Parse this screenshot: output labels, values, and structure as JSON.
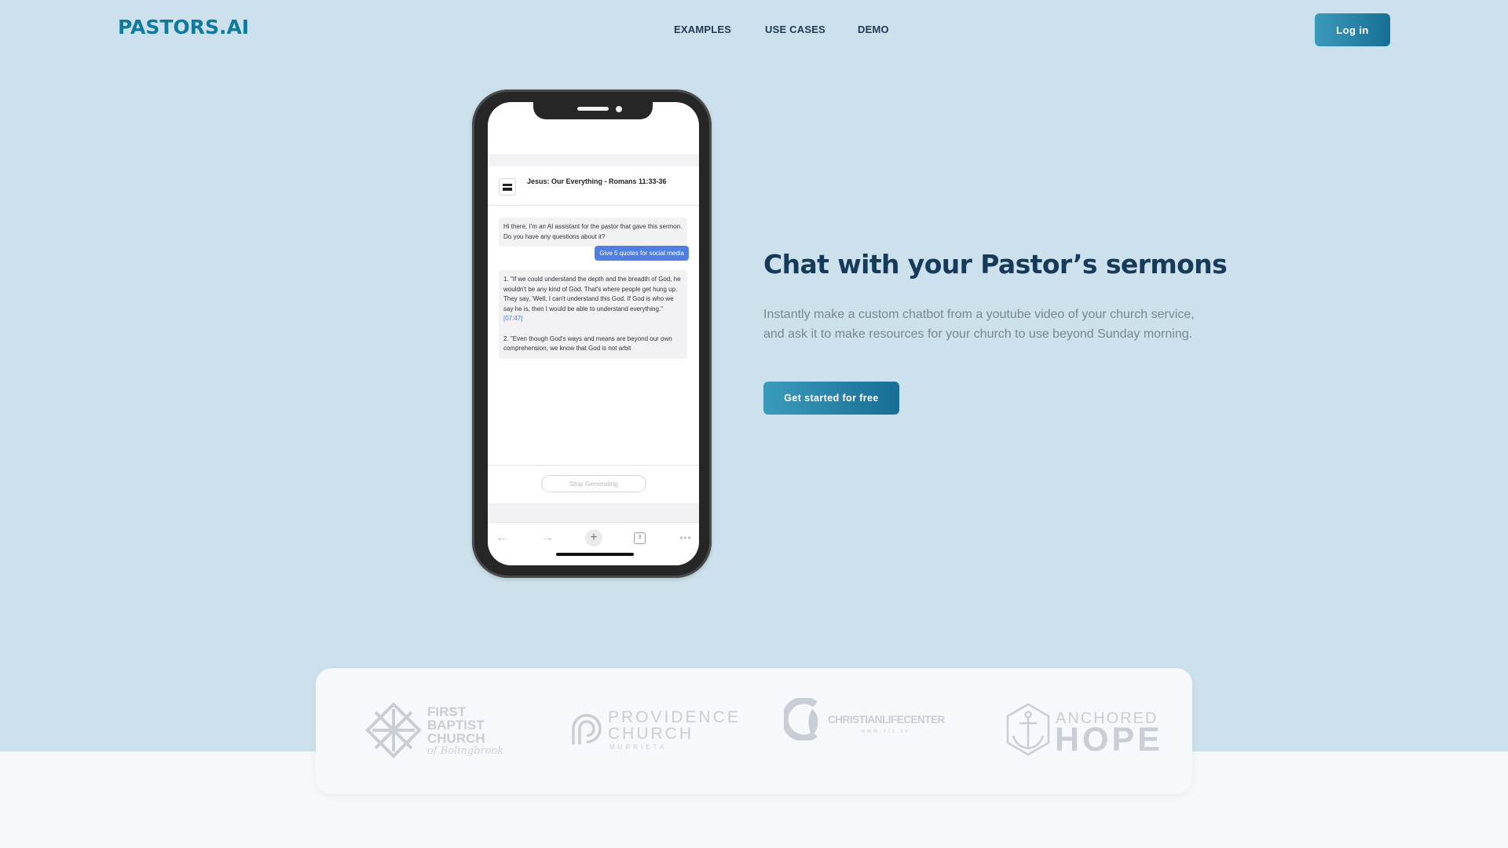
{
  "brand": {
    "name": "PASTORS.AI",
    "color": "#0f7aa0"
  },
  "nav": {
    "links": [
      {
        "label": "EXAMPLES"
      },
      {
        "label": "USE CASES"
      },
      {
        "label": "DEMO"
      }
    ],
    "login_label": "Log in"
  },
  "hero": {
    "title": "Chat with your Pastor’s sermons",
    "description": "Instantly make a custom chatbot from a youtube video of your church service, and ask it to make resources for your church to use beyond Sunday morning.",
    "cta_label": "Get started for free"
  },
  "phone_demo": {
    "sermon_title": "Jesus: Our Everything - Romans 11:33-36",
    "messages": [
      {
        "role": "assistant",
        "text": "Hi there, I'm an AI assistant for the pastor that gave this sermon. Do you have any questions about it?"
      },
      {
        "role": "user",
        "text": "Give 5 quotes for social media"
      },
      {
        "role": "assistant",
        "quote1": "1. \"If we could understand the depth and the breadth of God, he wouldn't be any kind of God. That's where people get hung up. They say, 'Well, I can't understand this God. If God is who we say he is, then I would be able to understand everything.\"",
        "quote1_timestamp": "[07:47]",
        "quote2": "2. \"Even though God's ways and means are beyond our own comprehension, we know that God is not arbit"
      }
    ],
    "stop_label": "Stop Generating",
    "browser_bar": {
      "icons": [
        "back-arrow-icon",
        "forward-arrow-icon",
        "plus-icon",
        "tabs-icon",
        "more-icon"
      ],
      "tab_count": "3"
    }
  },
  "churches": [
    {
      "name_lines": [
        "FIRST",
        "BAPTIST",
        "CHURCH"
      ],
      "script": "of Bolingbrook"
    },
    {
      "name_lines": [
        "PROVIDENCE",
        "CHURCH"
      ],
      "city": "MURRIETA"
    },
    {
      "name": "CHRISTIANLIFECENTER",
      "url": "www.clc.tv"
    },
    {
      "top": "ANCHORED",
      "bottom": "HOPE"
    }
  ],
  "colors": {
    "hero_bg": "#cce1ec",
    "page_bg": "#f6f8fc",
    "heading": "#163a5a",
    "button_gradient_start": "#3b9bbd",
    "button_gradient_end": "#176e94",
    "chat_user_bubble": "#4f7fe0"
  }
}
